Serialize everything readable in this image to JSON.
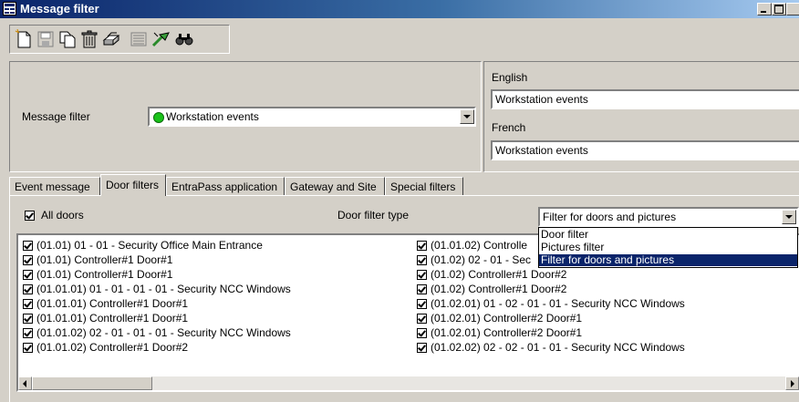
{
  "window": {
    "title": "Message filter"
  },
  "toolbar": {
    "buttons": [
      "new-icon",
      "save-icon",
      "copy-icon",
      "delete-icon",
      "print-icon",
      "list-icon",
      "link-icon",
      "find-icon"
    ]
  },
  "filter": {
    "label": "Message filter",
    "value": "Workstation events",
    "status_color": "#19c219"
  },
  "lang": {
    "english_label": "English",
    "english_value": "Workstation events",
    "french_label": "French",
    "french_value": "Workstation events"
  },
  "tabs": [
    "Event message",
    "Door filters",
    "EntraPass application",
    "Gateway and Site",
    "Special filters"
  ],
  "door_filters": {
    "all_doors_label": "All doors",
    "type_label": "Door filter type",
    "type_value": "Filter for doors and pictures",
    "options": [
      "Door filter",
      "Pictures filter",
      "Filter for doors and pictures"
    ],
    "left_column": [
      "(01.01) 01 - 01 - Security Office Main Entrance",
      "(01.01) Controller#1 Door#1",
      "(01.01) Controller#1 Door#1",
      "(01.01.01) 01 - 01 - 01 - 01 - Security NCC Windows",
      "(01.01.01) Controller#1 Door#1",
      "(01.01.01) Controller#1 Door#1",
      "(01.01.02) 02 - 01 - 01 - 01 - Security NCC Windows",
      "(01.01.02) Controller#1 Door#2"
    ],
    "right_column": [
      "(01.01.02) Controlle",
      "(01.02) 02 - 01 - Sec",
      "(01.02) Controller#1 Door#2",
      "(01.02) Controller#1 Door#2",
      "(01.02.01) 01 - 02 - 01 - 01 - Security NCC Windows",
      "(01.02.01) Controller#2 Door#1",
      "(01.02.01) Controller#2 Door#1",
      "(01.02.02) 02 - 02 - 01 - 01 - Security NCC Windows"
    ]
  },
  "colors": {
    "titlebar": "#0a246a",
    "selection": "#0a246a",
    "face": "#d4d0c8"
  }
}
